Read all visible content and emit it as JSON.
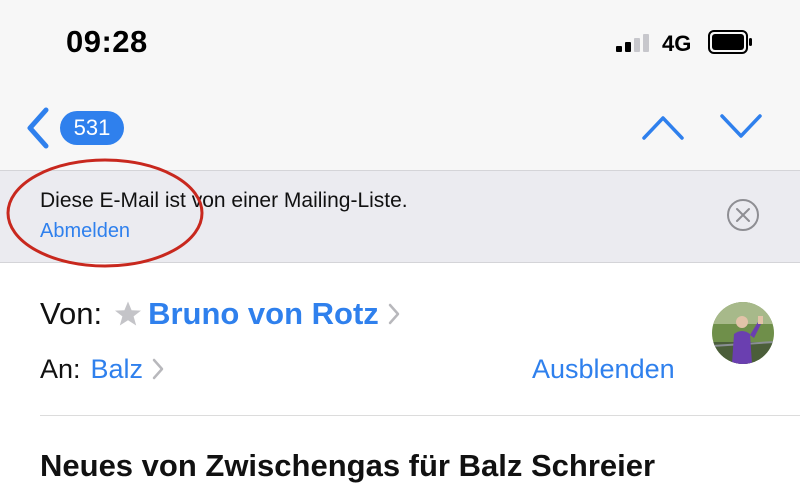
{
  "status_bar": {
    "time": "09:28",
    "network": "4G",
    "signal_icon": "cellular-signal-icon",
    "battery_icon": "battery-icon"
  },
  "nav": {
    "back_icon": "chevron-left-icon",
    "unread_count": "531",
    "previous_icon": "chevron-up-icon",
    "next_icon": "chevron-down-icon"
  },
  "banner": {
    "message": "Diese E-Mail ist von einer Mailing-Liste.",
    "action_label": "Abmelden",
    "dismiss_icon": "close-circle-icon"
  },
  "header": {
    "from_label": "Von:",
    "sender_name": "Bruno von Rotz",
    "vip_icon": "star-icon",
    "to_label": "An:",
    "recipient_name": "Balz",
    "hide_label": "Ausblenden",
    "avatar": "sender-avatar-photo"
  },
  "subject": "Neues von Zwischengas für Balz Schreier",
  "colors": {
    "accent": "#2f80ed",
    "annotation": "#c8281e",
    "banner_bg": "#ebebf0"
  }
}
